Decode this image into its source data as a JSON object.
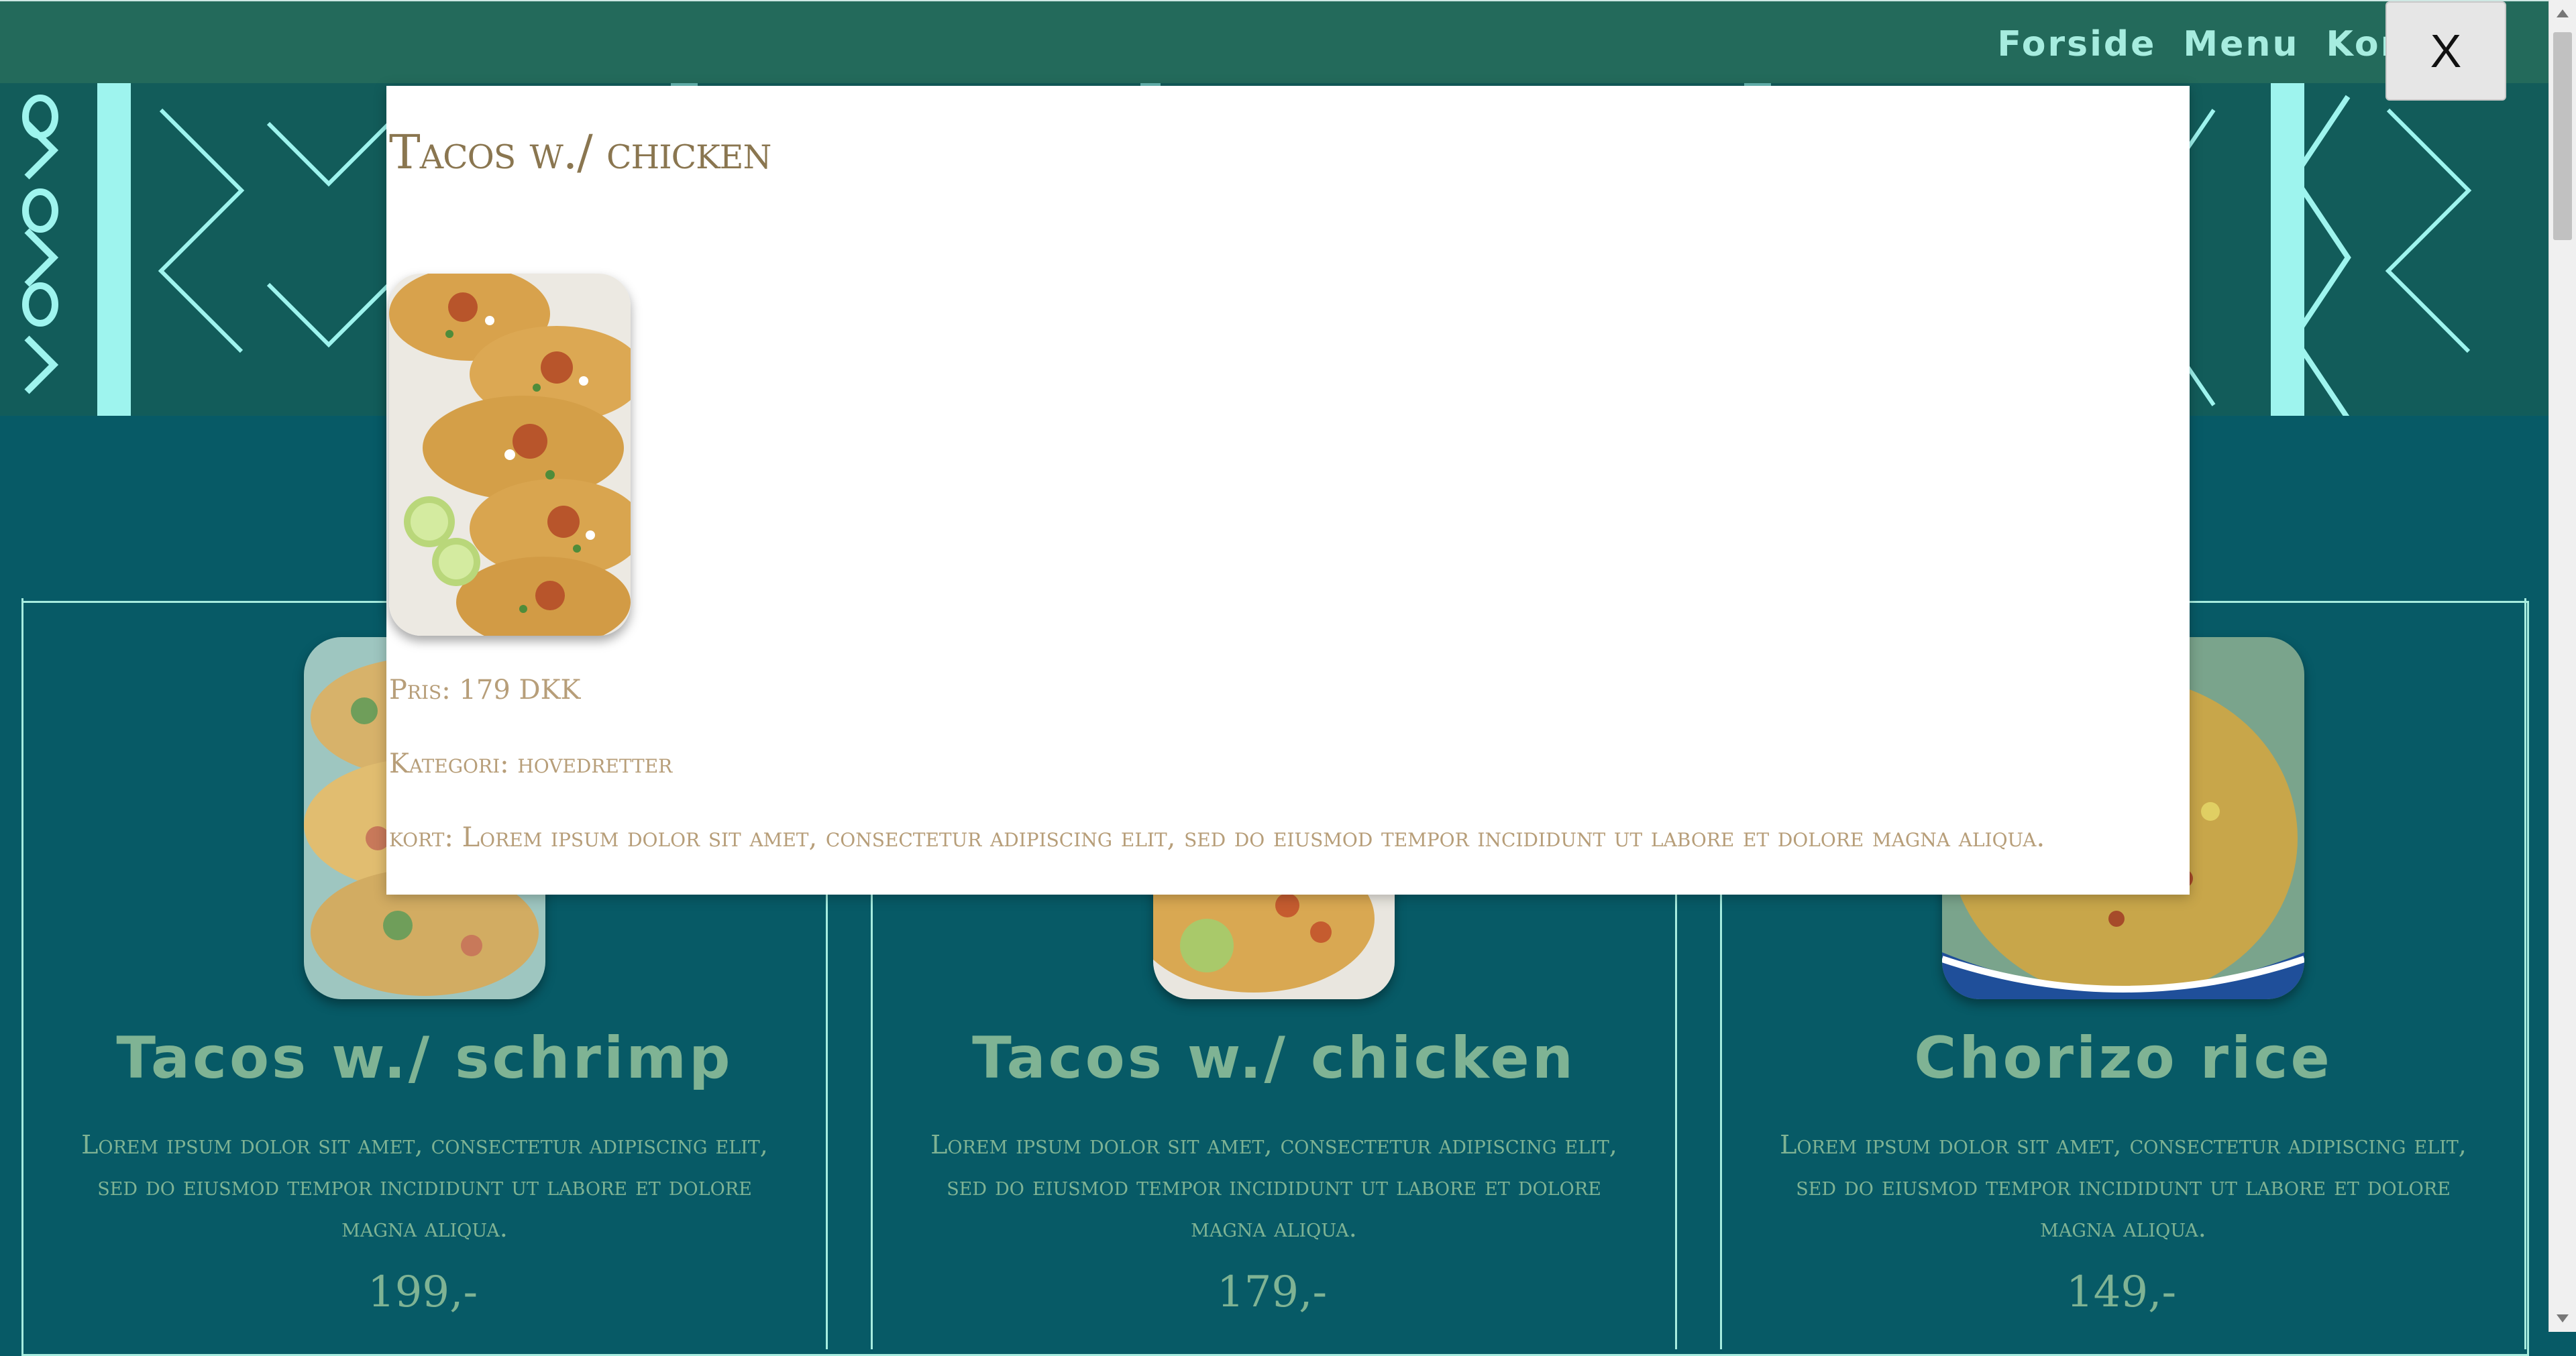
{
  "nav": {
    "items": [
      "Forside",
      "Menu",
      "Kontakt"
    ]
  },
  "modal": {
    "title": "Tacos w./ chicken",
    "image_alt": "tacos-chicken-photo",
    "price_line": "Pris: 179 DKK",
    "category_line": "Kategori: hovedretter",
    "short_line": "kort: Lorem ipsum dolor sit amet, consectetur adipiscing elit, sed do eiusmod tempor incididunt ut labore et dolore magna aliqua.",
    "close_label": "X"
  },
  "cards": [
    {
      "title": "Tacos w./ schrimp",
      "description": "Lorem ipsum dolor sit amet, consectetur adipiscing elit, sed do eiusmod tempor incididunt ut labore et dolore magna aliqua.",
      "price": "199,-"
    },
    {
      "title": "Tacos w./ chicken",
      "description": "Lorem ipsum dolor sit amet, consectetur adipiscing elit, sed do eiusmod tempor incididunt ut labore et dolore magna aliqua.",
      "price": "179,-"
    },
    {
      "title": "Chorizo rice",
      "description": "Lorem ipsum dolor sit amet, consectetur adipiscing elit, sed do eiusmod tempor incididunt ut labore et dolore magna aliqua.",
      "price": "149,-"
    }
  ],
  "colors": {
    "topbar": "#236a5b",
    "nav_text": "#a6ecdf",
    "page_bg": "#075a66",
    "card_text": "#7fb394",
    "modal_title": "#8a7650",
    "modal_text": "#b79e79"
  }
}
